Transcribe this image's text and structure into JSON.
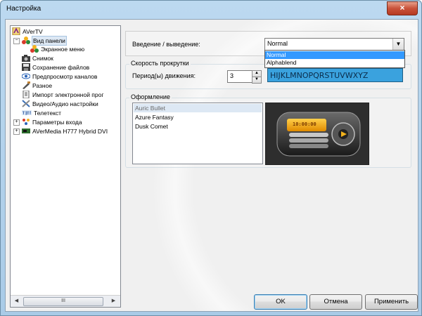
{
  "window": {
    "title": "Настройка",
    "close_glyph": "×"
  },
  "tree": {
    "items": [
      {
        "label": "AVerTV",
        "icon": "avertv-icon"
      },
      {
        "label": "Вид панели",
        "icon": "panel-view-icon"
      },
      {
        "label": "Экранное меню",
        "icon": "osd-menu-icon"
      },
      {
        "label": "Снимок",
        "icon": "snapshot-icon"
      },
      {
        "label": "Сохранение файлов",
        "icon": "file-save-icon"
      },
      {
        "label": "Предпросмотр каналов",
        "icon": "channel-preview-icon"
      },
      {
        "label": "Разное",
        "icon": "misc-icon"
      },
      {
        "label": "Импорт электронной прог",
        "icon": "epg-import-icon"
      },
      {
        "label": "Видео/Аудио настройки",
        "icon": "tools-icon"
      },
      {
        "label": "Телетекст",
        "icon": "teletext-icon"
      },
      {
        "label": "Параметры входа",
        "icon": "input-params-icon"
      },
      {
        "label": "AVerMedia H777 Hybrid DVI",
        "icon": "device-icon"
      }
    ],
    "minus": "−",
    "plus": "+",
    "scroll_left": "◀",
    "scroll_right": "▶",
    "thumb_grip": "III"
  },
  "transition": {
    "label": "Введение / выведение:",
    "value": "Normal",
    "options": [
      "Normal",
      "Alphablend"
    ],
    "arrow": "▼"
  },
  "scroll": {
    "legend": "Скорость прокрутки",
    "period_label": "Период(ы) движения:",
    "period_value": "3",
    "up": "▲",
    "down": "▼",
    "preview_text": "HIJKLMNOPQRSTUVWXYZ"
  },
  "skin": {
    "legend": "Оформление",
    "items": [
      "Auric Bullet",
      "Azure Fantasy",
      "Dusk Comet"
    ],
    "player_time": "10:00:00"
  },
  "buttons": {
    "ok": "OK",
    "cancel": "Отмена",
    "apply": "Применить"
  }
}
